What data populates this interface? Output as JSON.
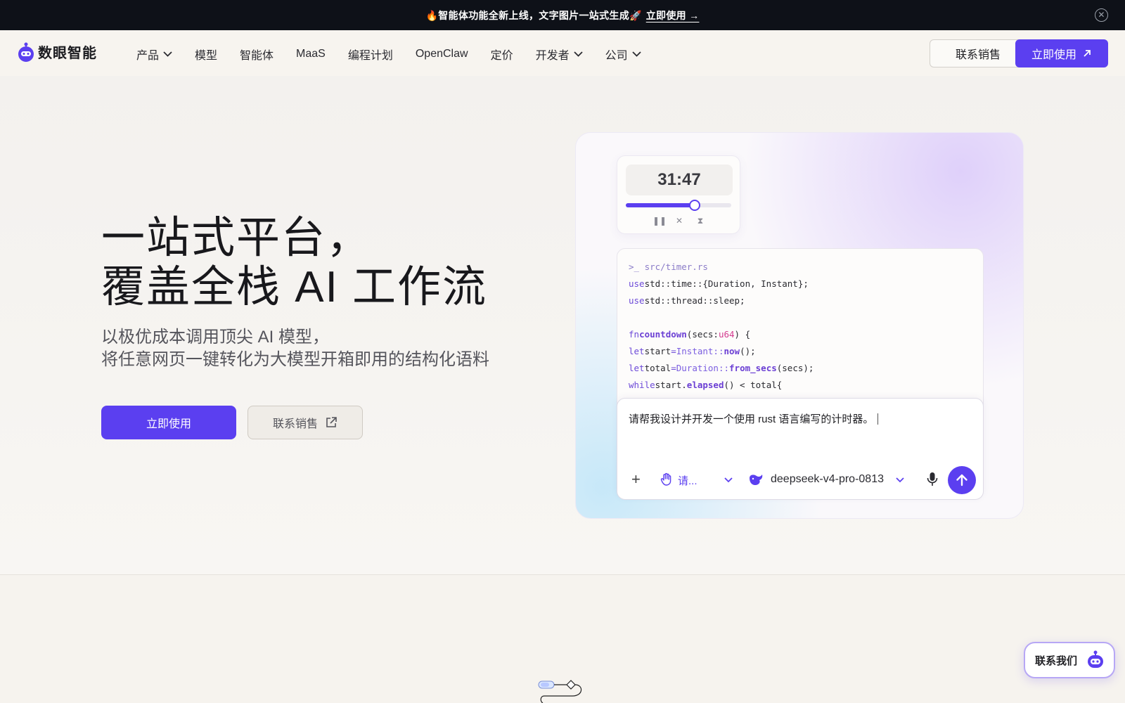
{
  "announcement": {
    "text": "🔥智能体功能全新上线，文字图片一站式生成🚀",
    "cta": "立即使用 →"
  },
  "nav": {
    "logo_text": "数眼智能",
    "items": [
      {
        "label": "产品",
        "dropdown": true
      },
      {
        "label": "模型",
        "dropdown": false
      },
      {
        "label": "智能体",
        "dropdown": false
      },
      {
        "label": "MaaS",
        "dropdown": false
      },
      {
        "label": "编程计划",
        "dropdown": false
      },
      {
        "label": "OpenClaw",
        "dropdown": false
      },
      {
        "label": "定价",
        "dropdown": false
      },
      {
        "label": "开发者",
        "dropdown": true
      },
      {
        "label": "公司",
        "dropdown": true
      }
    ],
    "contact_sales": "联系销售",
    "use_now": "立即使用"
  },
  "hero": {
    "title_line1": "一站式平台，",
    "title_line2": "覆盖全栈 AI 工作流",
    "sub_line1": "以极优成本调用顶尖 AI 模型，",
    "sub_line2": "将任意网页一键转化为大模型开箱即用的结构化语料",
    "primary_button": "立即使用",
    "secondary_button": "联系销售"
  },
  "demo": {
    "timer": {
      "display": "31:47",
      "progress": 0.65
    },
    "code": {
      "path": ">_ src/timer.rs",
      "lines": [
        [
          {
            "t": "use",
            "c": "kw"
          },
          {
            "t": "std::time::{Duration, Instant};",
            "c": ""
          }
        ],
        [
          {
            "t": "use",
            "c": "kw"
          },
          {
            "t": "std::thread::sleep;",
            "c": ""
          }
        ],
        [],
        [
          {
            "t": "fn",
            "c": "kw"
          },
          {
            "t": "countdown",
            "c": "fn"
          },
          {
            "t": "(secs:",
            "c": ""
          },
          {
            "t": "u64",
            "c": "pink"
          },
          {
            "t": ") {",
            "c": ""
          }
        ],
        [
          {
            "t": "let",
            "c": "kw"
          },
          {
            "t": "start",
            "c": ""
          },
          {
            "t": "=",
            "c": "kw"
          },
          {
            "t": "Instant::",
            "c": "ty"
          },
          {
            "t": "now",
            "c": "fn"
          },
          {
            "t": "();",
            "c": ""
          }
        ],
        [
          {
            "t": "let",
            "c": "kw"
          },
          {
            "t": "total",
            "c": ""
          },
          {
            "t": "=",
            "c": "kw"
          },
          {
            "t": "Duration::",
            "c": "ty"
          },
          {
            "t": "from_secs",
            "c": "fn"
          },
          {
            "t": "(secs);",
            "c": ""
          }
        ],
        [
          {
            "t": "while",
            "c": "kw"
          },
          {
            "t": "start.",
            "c": ""
          },
          {
            "t": "elapsed",
            "c": "fn"
          },
          {
            "t": "() < total{",
            "c": ""
          }
        ]
      ]
    },
    "chat": {
      "input_text": "请帮我设计并开发一个使用 rust 语言编写的计时器。",
      "mode_label": "请...",
      "model_label": "deepseek-v4-pro-0813"
    }
  },
  "floating": {
    "contact_us": "联系我们"
  },
  "colors": {
    "brand": "#5b3ff0",
    "announcement_bg": "#0e1118",
    "page_bg": "#f6f3ee"
  },
  "icons": [
    "close-icon",
    "chevron-down-icon",
    "arrow-up-right-icon",
    "external-link-icon",
    "pause-icon",
    "stop-icon",
    "hourglass-icon",
    "plus-icon",
    "hand-icon",
    "whale-icon",
    "mic-icon",
    "arrow-up-icon",
    "robot-icon"
  ]
}
